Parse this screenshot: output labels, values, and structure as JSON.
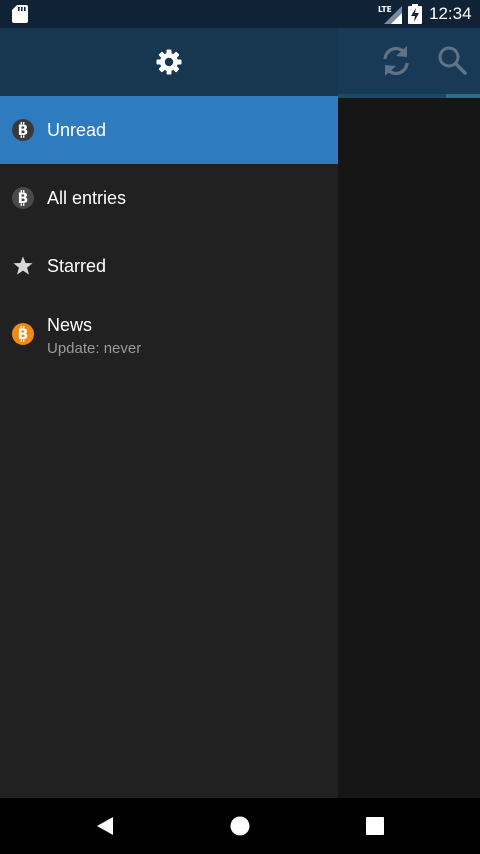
{
  "status_bar": {
    "time": "12:34",
    "network_label": "LTE",
    "icons": [
      "sd-card-icon",
      "lte-signal-icon",
      "battery-charging-icon"
    ]
  },
  "toolbar": {
    "icons": [
      "refresh-icon",
      "search-icon"
    ]
  },
  "drawer": {
    "header_icon": "gear-icon",
    "items": [
      {
        "label": "Unread",
        "icon": "bitcoin-icon",
        "selected": true
      },
      {
        "label": "All entries",
        "icon": "bitcoin-icon",
        "selected": false
      },
      {
        "label": "Starred",
        "icon": "star-icon",
        "selected": false
      },
      {
        "label": "News",
        "sublabel": "Update: never",
        "icon": "bitcoin-orange-icon",
        "selected": false
      }
    ]
  },
  "nav_bar": {
    "icons": [
      "back-icon",
      "home-icon",
      "recents-icon"
    ]
  },
  "colors": {
    "status_bar": "#0f2236",
    "header": "#173650",
    "selected": "#2e7bc0",
    "drawer_bg": "#212121",
    "bitcoin_orange": "#f08a16"
  }
}
